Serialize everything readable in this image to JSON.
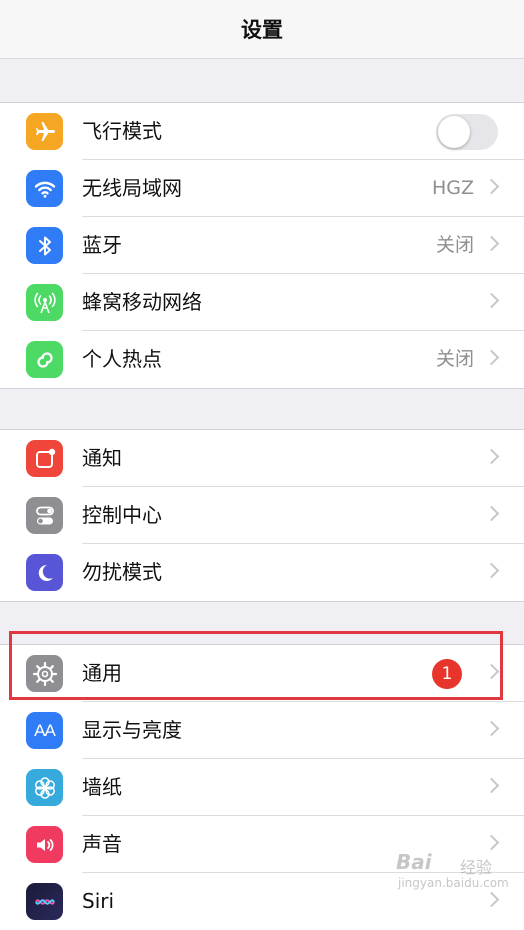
{
  "navbar": {
    "title": "设置"
  },
  "groups": [
    {
      "items": [
        {
          "name": "airplane-mode",
          "label": "飞行模式",
          "value": "",
          "control": "toggle",
          "toggle_on": false,
          "icon": "airplane-icon",
          "icon_color": "#f5a623"
        },
        {
          "name": "wifi",
          "label": "无线局域网",
          "value": "HGZ",
          "icon": "wifi-icon",
          "icon_color": "#2f7cf6"
        },
        {
          "name": "bluetooth",
          "label": "蓝牙",
          "value": "关闭",
          "icon": "bluetooth-icon",
          "icon_color": "#2f7cf6"
        },
        {
          "name": "cellular",
          "label": "蜂窝移动网络",
          "value": "",
          "icon": "antenna-icon",
          "icon_color": "#4cd964"
        },
        {
          "name": "hotspot",
          "label": "个人热点",
          "value": "关闭",
          "icon": "hotspot-icon",
          "icon_color": "#4cd964"
        }
      ]
    },
    {
      "items": [
        {
          "name": "notifications",
          "label": "通知",
          "value": "",
          "icon": "notification-icon",
          "icon_color": "#f0453a"
        },
        {
          "name": "control-center",
          "label": "控制中心",
          "value": "",
          "icon": "control-center-icon",
          "icon_color": "#8e8e93"
        },
        {
          "name": "do-not-disturb",
          "label": "勿扰模式",
          "value": "",
          "icon": "moon-icon",
          "icon_color": "#5856d6"
        }
      ]
    },
    {
      "items": [
        {
          "name": "general",
          "label": "通用",
          "value": "",
          "badge": "1",
          "icon": "gear-icon",
          "icon_color": "#8e8e93"
        },
        {
          "name": "display-brightness",
          "label": "显示与亮度",
          "value": "",
          "icon": "text-size-icon",
          "icon_color": "#2f7cf6",
          "icon_text": "AA"
        },
        {
          "name": "wallpaper",
          "label": "墙纸",
          "value": "",
          "icon": "flower-icon",
          "icon_color": "#36aadc"
        },
        {
          "name": "sounds",
          "label": "声音",
          "value": "",
          "icon": "speaker-icon",
          "icon_color": "#f03a5f"
        },
        {
          "name": "siri",
          "label": "Siri",
          "value": "",
          "icon": "siri-icon",
          "icon_color": "#1a1a3a"
        }
      ]
    }
  ],
  "watermark": {
    "brand": "Bai",
    "suffix": "经验",
    "url": "jingyan.baidu.com"
  },
  "colors": {
    "highlight": "#e0383e",
    "badge": "#e8352c",
    "background": "#efeff4"
  }
}
